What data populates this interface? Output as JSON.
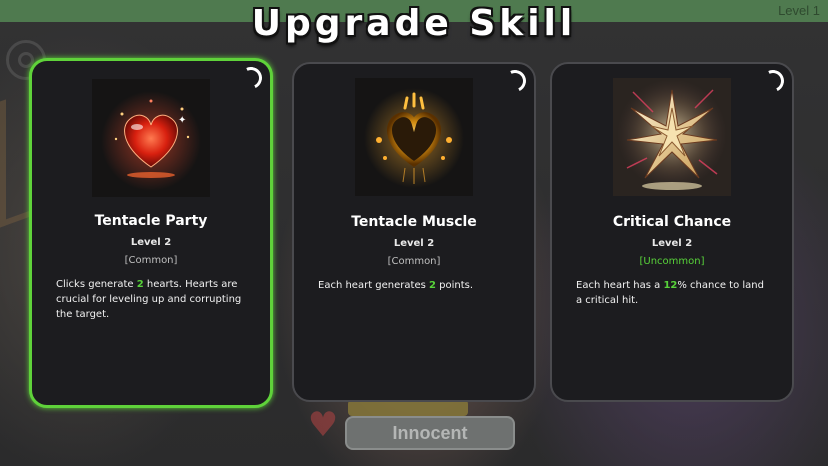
{
  "title": "Upgrade Skill",
  "top_bar": {
    "level_label": "Level 1"
  },
  "background": {
    "status_label": "Innocent"
  },
  "colors": {
    "accent_green": "#58d23a",
    "card_bg": "#1c1c1f",
    "selected_border": "#5fd23a"
  },
  "cards": [
    {
      "name": "Tentacle Party",
      "level": "Level 2",
      "rarity": "[Common]",
      "icon": "glowing-red-heart",
      "selected": true,
      "desc_pre": "Clicks generate ",
      "desc_value": "2",
      "desc_post": " hearts. Hearts are crucial for leveling up and corrupting the target."
    },
    {
      "name": "Tentacle Muscle",
      "level": "Level 2",
      "rarity": "[Common]",
      "icon": "golden-heart",
      "selected": false,
      "desc_pre": "Each heart generates ",
      "desc_value": "2",
      "desc_post": " points."
    },
    {
      "name": "Critical Chance",
      "level": "Level 2",
      "rarity": "[Uncommon]",
      "icon": "star-burst",
      "selected": false,
      "desc_pre": "Each heart has a ",
      "desc_value": "12",
      "desc_post": "% chance to land a critical hit."
    }
  ]
}
